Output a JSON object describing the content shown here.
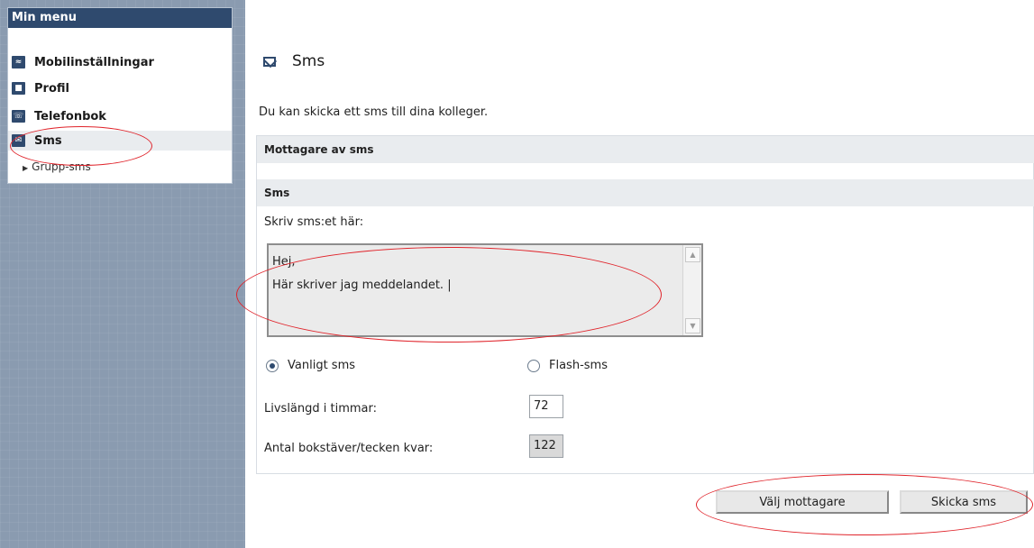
{
  "menu": {
    "title": "Min menu",
    "items": [
      {
        "label": "Mobilinställningar",
        "icon": "mobile-settings-icon"
      },
      {
        "label": "Profil",
        "icon": "profile-icon"
      },
      {
        "label": "Telefonbok",
        "icon": "phonebook-icon"
      },
      {
        "label": "Sms",
        "icon": "envelope-icon",
        "active": true
      }
    ],
    "subitem": "Grupp-sms"
  },
  "page": {
    "title": "Sms",
    "intro": "Du kan skicka ett sms till dina kolleger."
  },
  "sections": {
    "recipients": "Mottagare av sms",
    "sms": "Sms"
  },
  "form": {
    "message_label": "Skriv sms:et här:",
    "message_value": "Hej,\nHär skriver jag meddelandet. |",
    "radio_normal": "Vanligt sms",
    "radio_flash": "Flash-sms",
    "selected_type": "Vanligt sms",
    "lifetime_label": "Livslängd i timmar:",
    "lifetime_value": "72",
    "chars_left_label": "Antal bokstäver/tecken kvar:",
    "chars_left_value": "122"
  },
  "buttons": {
    "choose_recipients": "Välj mottagare",
    "send": "Skicka sms"
  },
  "colors": {
    "header_navy": "#2f4a6e",
    "sidebar_bg": "#8a9bb0",
    "annotation_red": "#e0242b"
  }
}
